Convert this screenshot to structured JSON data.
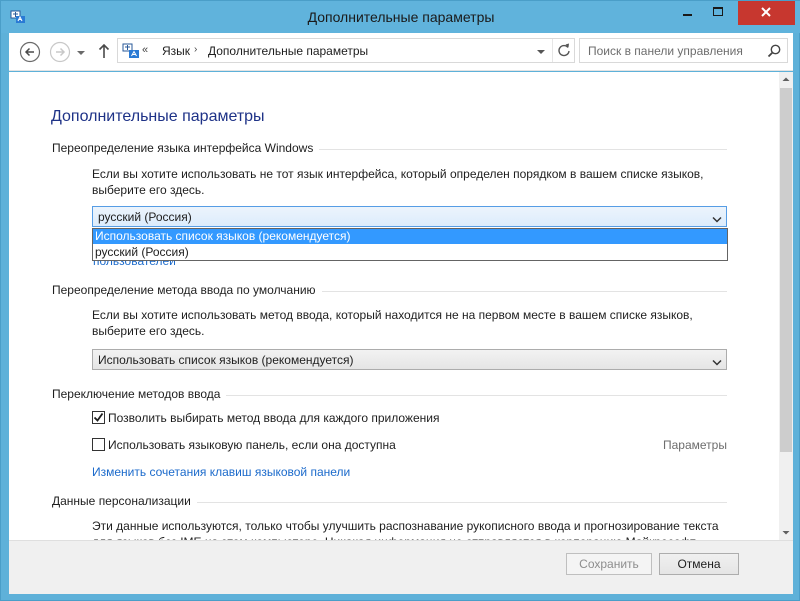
{
  "window": {
    "title": "Дополнительные параметры"
  },
  "nav": {
    "breadcrumb_chevron": "«",
    "crumbs": [
      "Язык",
      "Дополнительные параметры"
    ],
    "breadcrumb_separator": "›",
    "search_placeholder": "Поиск в панели управления"
  },
  "page": {
    "title": "Дополнительные параметры",
    "sections": [
      {
        "title": "Переопределение языка интерфейса Windows",
        "description": "Если вы хотите использовать не тот язык интерфейса, который определен порядком в вашем списке языков, выберите его здесь.",
        "select_value": "русский (Россия)",
        "options": [
          "Использовать список языков (рекомендуется)",
          "русский (Россия)"
        ],
        "link_partial": "пользователей"
      },
      {
        "title": "Переопределение метода ввода по умолчанию",
        "description": "Если вы хотите использовать метод ввода, который находится не на первом месте в вашем списке языков, выберите его здесь.",
        "select_value": "Использовать список языков (рекомендуется)"
      },
      {
        "title": "Переключение методов ввода",
        "checkbox1": {
          "label": "Позволить выбирать метод ввода для каждого приложения",
          "checked": true
        },
        "checkbox2": {
          "label": "Использовать языковую панель, если она доступна",
          "checked": false
        },
        "params_link": "Параметры",
        "hotkeys_link": "Изменить сочетания клавиш языковой панели"
      },
      {
        "title": "Данные персонализации",
        "description": "Эти данные используются, только чтобы улучшить распознавание рукописного ввода и прогнозирование текста для языков без IME на этом компьютере. Никакая информация не отправляется в корпорацию Майкрософт."
      }
    ]
  },
  "buttons": {
    "save": "Сохранить",
    "cancel": "Отмена"
  },
  "colors": {
    "titlebar": "#60b3dc",
    "close": "#c7372f",
    "link": "#1b6acb",
    "heading": "#1e3287",
    "selection": "#3399ff"
  }
}
